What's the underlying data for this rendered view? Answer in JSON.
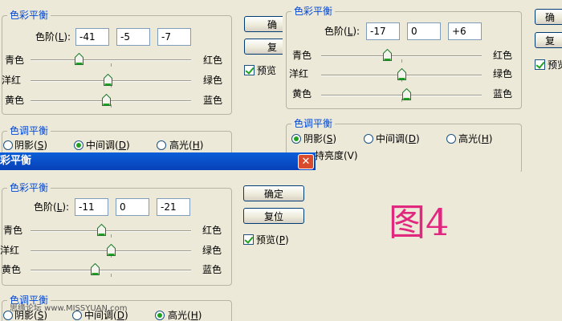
{
  "common": {
    "color_balance": "色彩平衡",
    "levels": "色阶(L):",
    "cyan": "青色",
    "red": "红色",
    "magenta": "洋红",
    "green": "绿色",
    "yellow": "黄色",
    "blue": "蓝色",
    "tone_balance": "色调平衡",
    "shadows": "阴影(S)",
    "midtones": "中间调(D)",
    "highlights": "高光(H)",
    "preserve": "保持亮度(V)",
    "ok": "确定",
    "reset": "复位",
    "preview": "预览(P)",
    "ok_cut": "确",
    "reset_cut": "复",
    "preview_cut": "预览",
    "preserve_cut": "持亮度(V)"
  },
  "panel1": {
    "levels": [
      "-41",
      "-5",
      "-7"
    ],
    "slider_fraction": [
      0.3,
      0.48,
      0.47
    ],
    "tone_selected": "midtones"
  },
  "panel2": {
    "levels": [
      "-17",
      "0",
      "+6"
    ],
    "slider_fraction": [
      0.41,
      0.5,
      0.53
    ],
    "tone_selected": "shadows"
  },
  "panel3": {
    "title": "彩平衡",
    "levels": [
      "-11",
      "0",
      "-21"
    ],
    "slider_fraction": [
      0.44,
      0.5,
      0.4
    ],
    "tone_selected": "highlights"
  },
  "figure_label": "图4",
  "watermark": "思缘论坛 www.MISSYUAN.com",
  "colors": {
    "figure_label": "#e0287f",
    "legend": "#0046d5",
    "accent_thumb": "#21a121"
  }
}
